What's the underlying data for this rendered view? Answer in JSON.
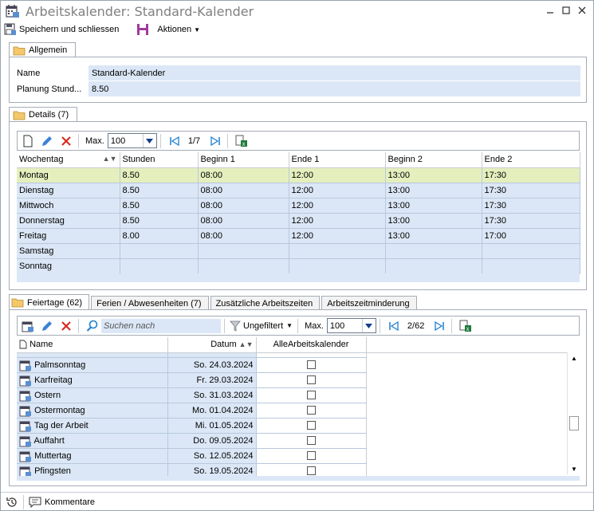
{
  "window": {
    "title": "Arbeitskalender: Standard-Kalender",
    "controls": [
      "minimize",
      "maximize",
      "close"
    ]
  },
  "toolbar": {
    "save_close_label": "Speichern und schliessen",
    "actions_label": "Aktionen"
  },
  "allgemein": {
    "tab_label": "Allgemein",
    "fields": [
      {
        "label": "Name",
        "value": "Standard-Kalender"
      },
      {
        "label": "Planung  Stund...",
        "value": "8.50"
      }
    ]
  },
  "details": {
    "tab_label": "Details (7)",
    "max_label": "Max.",
    "max_value": "100",
    "pager": "1/7",
    "columns": [
      "Wochentag",
      "Stunden",
      "Beginn 1",
      "Ende 1",
      "Beginn 2",
      "Ende 2"
    ],
    "rows": [
      [
        "Montag",
        "8.50",
        "08:00",
        "12:00",
        "13:00",
        "17:30"
      ],
      [
        "Dienstag",
        "8.50",
        "08:00",
        "12:00",
        "13:00",
        "17:30"
      ],
      [
        "Mittwoch",
        "8.50",
        "08:00",
        "12:00",
        "13:00",
        "17:30"
      ],
      [
        "Donnerstag",
        "8.50",
        "08:00",
        "12:00",
        "13:00",
        "17:30"
      ],
      [
        "Freitag",
        "8.00",
        "08:00",
        "12:00",
        "13:00",
        "17:00"
      ],
      [
        "Samstag",
        "",
        "",
        "",
        "",
        ""
      ],
      [
        "Sonntag",
        "",
        "",
        "",
        "",
        ""
      ]
    ]
  },
  "feiertage": {
    "tabs": [
      "Feiertage (62)",
      "Ferien / Abwesenheiten (7)",
      "Zusätzliche Arbeitszeiten",
      "Arbeitszeitminderung"
    ],
    "search_placeholder": "Suchen nach",
    "filter_label": "Ungefiltert",
    "max_label": "Max.",
    "max_value": "100",
    "pager": "2/62",
    "columns": [
      "Name",
      "Datum",
      "AlleArbeitskalender"
    ],
    "rows": [
      {
        "name": "Palmsonntag",
        "date": "So. 24.03.2024"
      },
      {
        "name": "Karfreitag",
        "date": "Fr. 29.03.2024"
      },
      {
        "name": "Ostern",
        "date": "So. 31.03.2024"
      },
      {
        "name": "Ostermontag",
        "date": "Mo. 01.04.2024"
      },
      {
        "name": "Tag der Arbeit",
        "date": "Mi. 01.05.2024"
      },
      {
        "name": "Auffahrt",
        "date": "Do. 09.05.2024"
      },
      {
        "name": "Muttertag",
        "date": "So. 12.05.2024"
      },
      {
        "name": "Pfingsten",
        "date": "So. 19.05.2024"
      }
    ]
  },
  "status": {
    "comments_label": "Kommentare"
  }
}
